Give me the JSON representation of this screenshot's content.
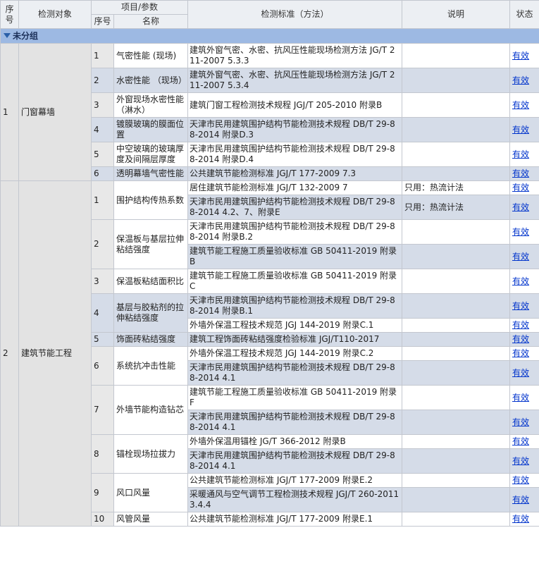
{
  "headers": {
    "seq": "序号",
    "object": "检测对象",
    "item_param": "项目/参数",
    "item_seq": "序号",
    "item_name": "名称",
    "standard": "检测标准（方法）",
    "note": "说明",
    "status": "状态"
  },
  "group_label": "未分组",
  "groups": [
    {
      "seq": "1",
      "object": "门窗幕墙",
      "items": [
        {
          "num": "1",
          "name": "气密性能 (现场)",
          "standards": [
            {
              "text": "建筑外窗气密、水密、抗风压性能现场检测方法 JG/T 211-2007 5.3.3",
              "note": "",
              "status": "有效"
            }
          ]
        },
        {
          "num": "2",
          "name": "水密性能 （现场）",
          "standards": [
            {
              "text": "建筑外窗气密、水密、抗风压性能现场检测方法 JG/T 211-2007 5.3.4",
              "note": "",
              "status": "有效"
            }
          ]
        },
        {
          "num": "3",
          "name": "外窗现场水密性能（淋水）",
          "standards": [
            {
              "text": "建筑门窗工程检测技术规程 JGJ/T 205-2010 附录B",
              "note": "",
              "status": "有效"
            }
          ]
        },
        {
          "num": "4",
          "name": "镀膜玻璃的膜面位置",
          "standards": [
            {
              "text": "天津市民用建筑围护结构节能检测技术规程 DB/T 29-88-2014 附录D.3",
              "note": "",
              "status": "有效"
            }
          ]
        },
        {
          "num": "5",
          "name": "中空玻璃的玻璃厚度及间隔层厚度",
          "standards": [
            {
              "text": "天津市民用建筑围护结构节能检测技术规程 DB/T 29-88-2014 附录D.4",
              "note": "",
              "status": "有效"
            }
          ]
        },
        {
          "num": "6",
          "name": "透明幕墙气密性能",
          "standards": [
            {
              "text": "公共建筑节能检测标准 JGJ/T 177-2009 7.3",
              "note": "",
              "status": "有效"
            }
          ]
        }
      ]
    },
    {
      "seq": "2",
      "object": "建筑节能工程",
      "items": [
        {
          "num": "1",
          "name": "围护结构传热系数",
          "standards": [
            {
              "text": "居住建筑节能检测标准 JGJ/T 132-2009 7",
              "note": "只用：热流计法",
              "status": "有效"
            },
            {
              "text": "天津市民用建筑围护结构节能检测技术规程 DB/T 29-88-2014 4.2、7、附录E",
              "note": "只用：热流计法",
              "status": "有效"
            }
          ]
        },
        {
          "num": "2",
          "name": "保温板与基层拉伸粘结强度",
          "standards": [
            {
              "text": "天津市民用建筑围护结构节能检测技术规程 DB/T 29-88-2014 附录B.2",
              "note": "",
              "status": "有效"
            },
            {
              "text": "建筑节能工程施工质量验收标准 GB 50411-2019 附录B",
              "note": "",
              "status": "有效"
            }
          ]
        },
        {
          "num": "3",
          "name": "保温板粘结面积比",
          "standards": [
            {
              "text": "建筑节能工程施工质量验收标准 GB 50411-2019 附录C",
              "note": "",
              "status": "有效"
            }
          ]
        },
        {
          "num": "4",
          "name": "基层与胶粘剂的拉伸粘结强度",
          "standards": [
            {
              "text": "天津市民用建筑围护结构节能检测技术规程 DB/T 29-88-2014 附录B.1",
              "note": "",
              "status": "有效"
            },
            {
              "text": "外墙外保温工程技术规范 JGJ 144-2019 附录C.1",
              "note": "",
              "status": "有效"
            }
          ]
        },
        {
          "num": "5",
          "name": "饰面砖粘结强度",
          "standards": [
            {
              "text": "建筑工程饰面砖粘结强度检验标准 JGJ/T110-2017",
              "note": "",
              "status": "有效"
            }
          ]
        },
        {
          "num": "6",
          "name": "系统抗冲击性能",
          "standards": [
            {
              "text": "外墙外保温工程技术规范 JGJ 144-2019 附录C.2",
              "note": "",
              "status": "有效"
            },
            {
              "text": "天津市民用建筑围护结构节能检测技术规程 DB/T 29-88-2014 4.1",
              "note": "",
              "status": "有效"
            }
          ]
        },
        {
          "num": "7",
          "name": "外墙节能构造钻芯",
          "standards": [
            {
              "text": "建筑节能工程施工质量验收标准 GB 50411-2019 附录F",
              "note": "",
              "status": "有效"
            },
            {
              "text": "天津市民用建筑围护结构节能检测技术规程 DB/T 29-88-2014 4.1",
              "note": "",
              "status": "有效"
            }
          ]
        },
        {
          "num": "8",
          "name": "锚栓现场拉拔力",
          "standards": [
            {
              "text": "外墙外保温用锚栓 JG/T 366-2012 附录B",
              "note": "",
              "status": "有效"
            },
            {
              "text": "天津市民用建筑围护结构节能检测技术规程 DB/T 29-88-2014 4.1",
              "note": "",
              "status": "有效"
            }
          ]
        },
        {
          "num": "9",
          "name": "风口风量",
          "standards": [
            {
              "text": "公共建筑节能检测标准 JGJ/T 177-2009 附录E.2",
              "note": "",
              "status": "有效"
            },
            {
              "text": "采暖通风与空气调节工程检测技术规程 JGJ/T 260-2011 3.4.4",
              "note": "",
              "status": "有效"
            }
          ]
        },
        {
          "num": "10",
          "name": "风管风量",
          "standards": [
            {
              "text": "公共建筑节能检测标准 JGJ/T 177-2009 附录E.1",
              "note": "",
              "status": "有效"
            }
          ]
        }
      ]
    }
  ]
}
